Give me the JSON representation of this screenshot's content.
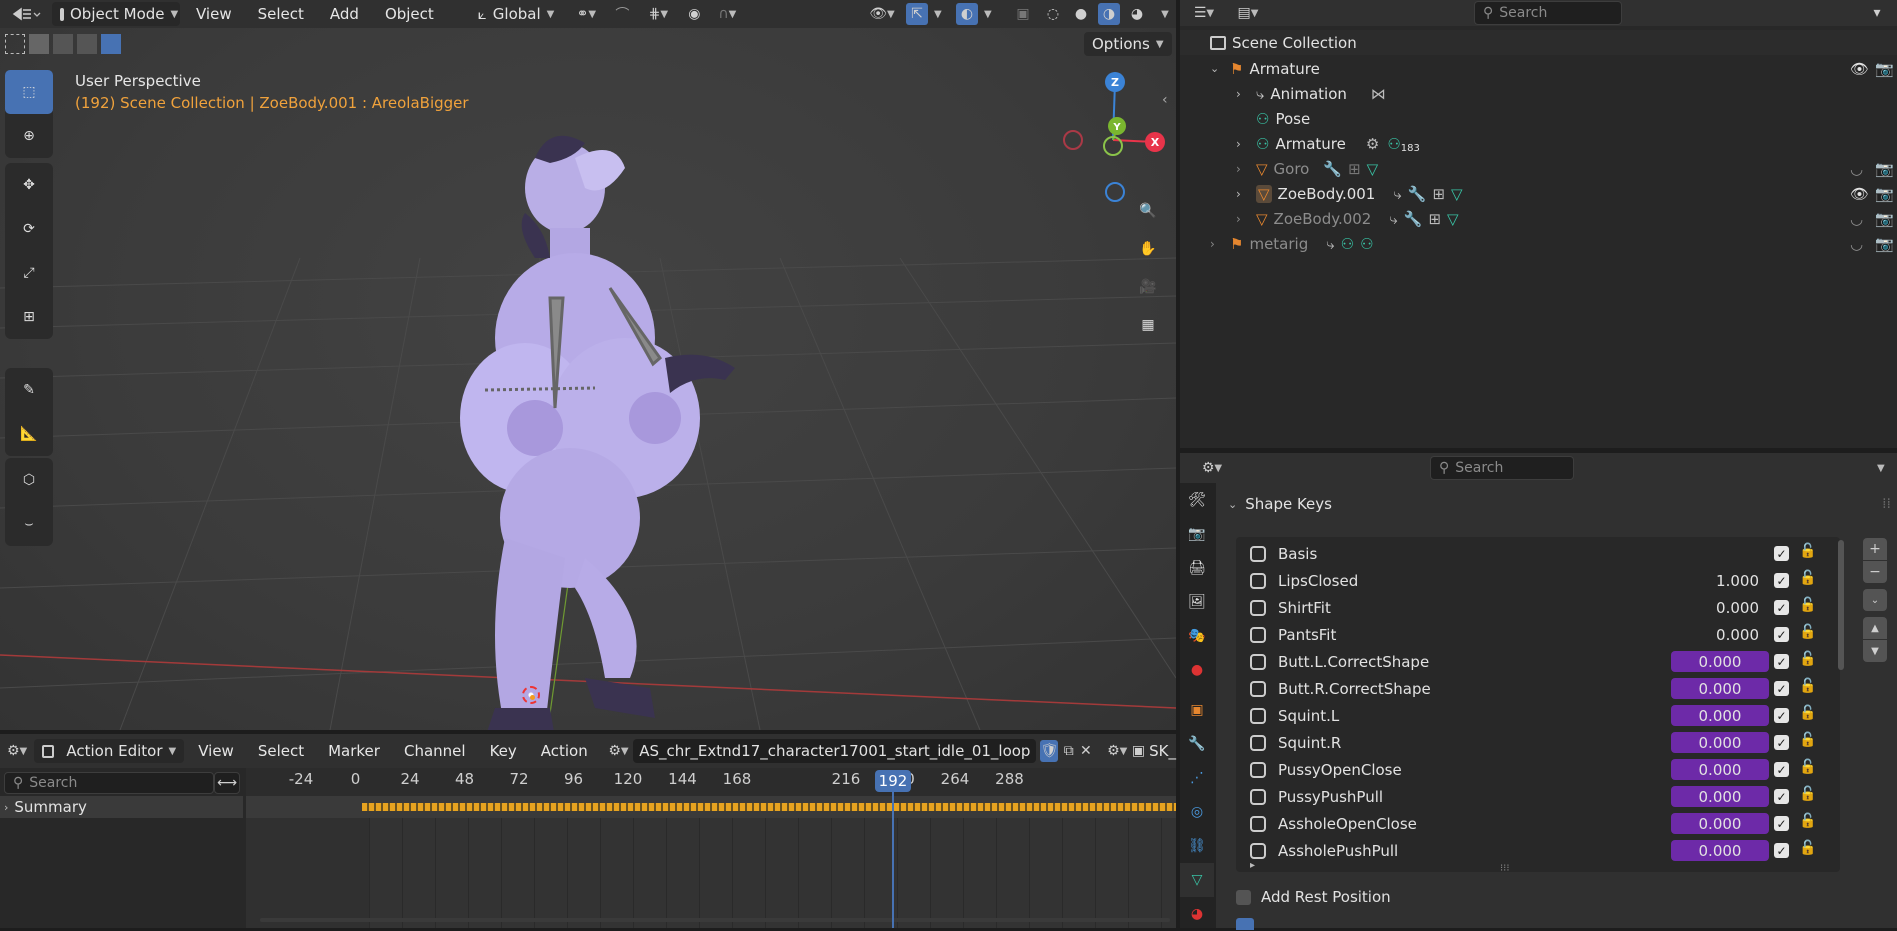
{
  "viewport_header": {
    "mode": "Object Mode",
    "menus": [
      "View",
      "Select",
      "Add",
      "Object"
    ],
    "transform_orientation": "Global",
    "options_label": "Options"
  },
  "viewport_overlay": {
    "perspective": "User Perspective",
    "collection_info": "(192) Scene Collection | ZoeBody.001 : AreolaBigger",
    "gizmo_axes": {
      "z": "Z",
      "y": "Y",
      "x": "X"
    },
    "axis_colors": {
      "x": "#e8344a",
      "y": "#7ab62f",
      "z": "#3b83d6"
    }
  },
  "tools": [
    "select-box-icon",
    "cursor-icon",
    "move-icon",
    "rotate-icon",
    "scale-icon",
    "transform-icon",
    "annotate-icon",
    "measure-icon",
    "add-cube-icon",
    "curve-icon"
  ],
  "outliner": {
    "search_placeholder": "Search",
    "root": "Scene Collection",
    "items": [
      {
        "label": "Armature",
        "dim": false,
        "icon": "armature-icon"
      },
      {
        "label": "Animation",
        "dim": false,
        "icon": "animation-icon"
      },
      {
        "label": "Pose",
        "dim": false,
        "icon": "pose-icon"
      },
      {
        "label": "Armature",
        "dim": false,
        "icon": "armature-data-icon",
        "count": "183"
      },
      {
        "label": "Goro",
        "dim": true,
        "icon": "mesh-icon"
      },
      {
        "label": "ZoeBody.001",
        "dim": false,
        "icon": "mesh-icon"
      },
      {
        "label": "ZoeBody.002",
        "dim": true,
        "icon": "mesh-icon"
      },
      {
        "label": "metarig",
        "dim": true,
        "icon": "armature-icon"
      }
    ]
  },
  "properties": {
    "search_placeholder": "Search",
    "panel_title": "Shape Keys",
    "shape_keys": [
      {
        "name": "Basis",
        "value": ""
      },
      {
        "name": "LipsClosed",
        "value": "1.000"
      },
      {
        "name": "ShirtFit",
        "value": "0.000"
      },
      {
        "name": "PantsFit",
        "value": "0.000"
      },
      {
        "name": "Butt.L.CorrectShape",
        "value": "0.000"
      },
      {
        "name": "Butt.R.CorrectShape",
        "value": "0.000"
      },
      {
        "name": "Squint.L",
        "value": "0.000"
      },
      {
        "name": "Squint.R",
        "value": "0.000"
      },
      {
        "name": "PussyOpenClose",
        "value": "0.000"
      },
      {
        "name": "PussyPushPull",
        "value": "0.000"
      },
      {
        "name": "AssholeOpenClose",
        "value": "0.000"
      },
      {
        "name": "AssholePushPull",
        "value": "0.000"
      }
    ],
    "add_rest_position": "Add Rest Position"
  },
  "action_editor": {
    "editor": "Action Editor",
    "menus": [
      "View",
      "Select",
      "Marker",
      "Channel",
      "Key",
      "Action"
    ],
    "action_name": "AS_chr_Extnd17_character17001_start_idle_01_loop",
    "sk_label": "SK_",
    "search_placeholder": "Search",
    "summary": "Summary",
    "ticks": [
      "-24",
      "0",
      "24",
      "48",
      "72",
      "96",
      "120",
      "144",
      "168",
      "192",
      "216",
      "240",
      "264",
      "288"
    ],
    "current_frame": "192"
  }
}
